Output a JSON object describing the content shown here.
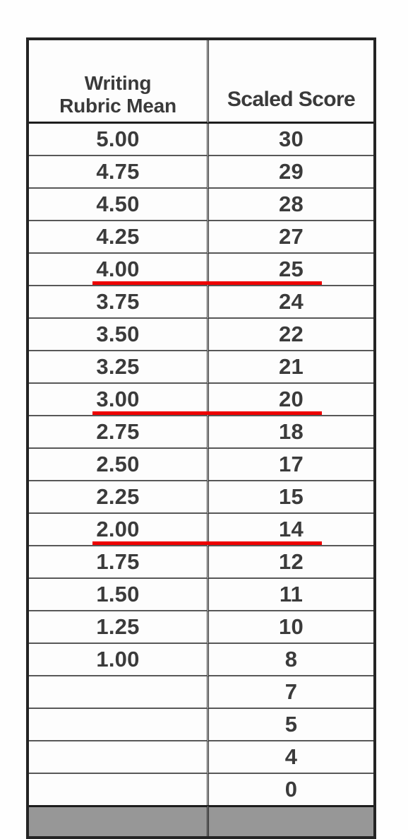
{
  "table": {
    "columns": [
      {
        "id": "rubric",
        "label_line1": "Writing",
        "label_line2": "Rubric Mean"
      },
      {
        "id": "scaled",
        "label": "Scaled Score"
      }
    ],
    "rows": [
      {
        "rubric": "5.00",
        "scaled": "30",
        "marked": false
      },
      {
        "rubric": "4.75",
        "scaled": "29",
        "marked": false
      },
      {
        "rubric": "4.50",
        "scaled": "28",
        "marked": false
      },
      {
        "rubric": "4.25",
        "scaled": "27",
        "marked": false
      },
      {
        "rubric": "4.00",
        "scaled": "25",
        "marked": true
      },
      {
        "rubric": "3.75",
        "scaled": "24",
        "marked": false
      },
      {
        "rubric": "3.50",
        "scaled": "22",
        "marked": false
      },
      {
        "rubric": "3.25",
        "scaled": "21",
        "marked": false
      },
      {
        "rubric": "3.00",
        "scaled": "20",
        "marked": true
      },
      {
        "rubric": "2.75",
        "scaled": "18",
        "marked": false
      },
      {
        "rubric": "2.50",
        "scaled": "17",
        "marked": false
      },
      {
        "rubric": "2.25",
        "scaled": "15",
        "marked": false
      },
      {
        "rubric": "2.00",
        "scaled": "14",
        "marked": true
      },
      {
        "rubric": "1.75",
        "scaled": "12",
        "marked": false
      },
      {
        "rubric": "1.50",
        "scaled": "11",
        "marked": false
      },
      {
        "rubric": "1.25",
        "scaled": "10",
        "marked": false
      },
      {
        "rubric": "1.00",
        "scaled": "8",
        "marked": false
      },
      {
        "rubric": "",
        "scaled": "7",
        "marked": false
      },
      {
        "rubric": "",
        "scaled": "5",
        "marked": false
      },
      {
        "rubric": "",
        "scaled": "4",
        "marked": false
      },
      {
        "rubric": "",
        "scaled": "0",
        "marked": false
      }
    ],
    "footer_row": {
      "rubric": "",
      "scaled": ""
    },
    "highlight_color": "#ee0000",
    "footer_fill_color": "#979797",
    "border_color": "#1d1d1d"
  }
}
